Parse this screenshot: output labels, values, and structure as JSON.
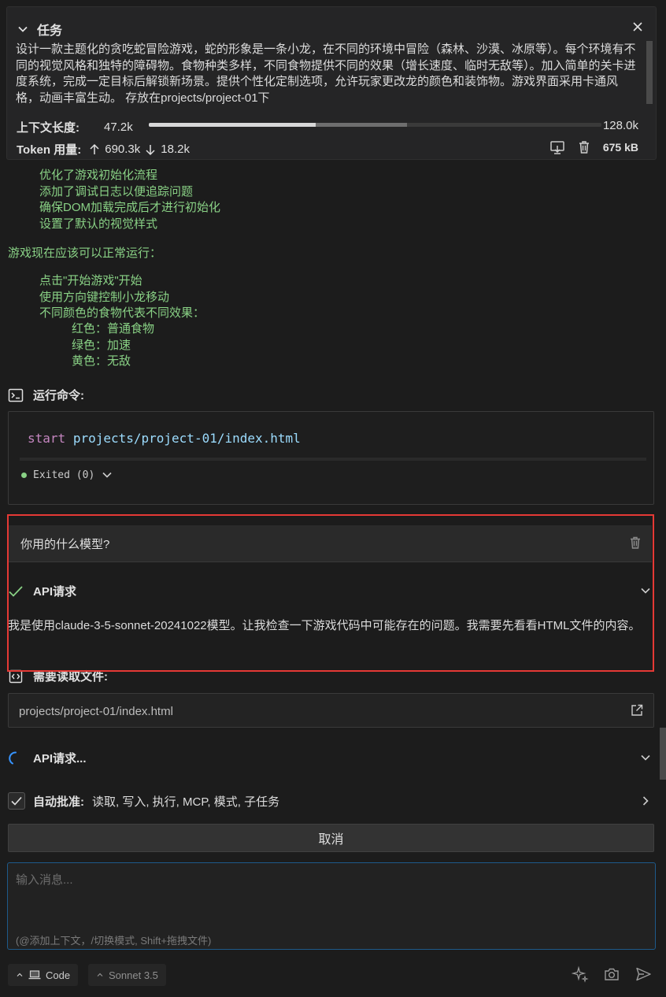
{
  "task": {
    "title": "任务",
    "description": "设计一款主题化的贪吃蛇冒险游戏，蛇的形象是一条小龙，在不同的环境中冒险（森林、沙漠、冰原等）。每个环境有不同的视觉风格和独特的障碍物。食物种类多样，不同食物提供不同的效果（增长速度、临时无敌等）。加入简单的关卡进度系统，完成一定目标后解锁新场景。提供个性化定制选项，允许玩家更改龙的颜色和装饰物。游戏界面采用卡通风格，动画丰富生动。 存放在projects/project-01下",
    "context_label": "上下文长度:",
    "context_used": "47.2k",
    "context_max": "128.0k",
    "context_used_fraction": 0.369,
    "context_cache_fraction": 0.201,
    "token_label": "Token 用量:",
    "tokens_in": "690.3k",
    "tokens_out": "18.2k",
    "size": "675 kB"
  },
  "assistant": {
    "list1": [
      "优化了游戏初始化流程",
      "添加了调试日志以便追踪问题",
      "确保DOM加载完成后才进行初始化",
      "设置了默认的视觉样式"
    ],
    "line": "游戏现在应该可以正常运行：",
    "list2": [
      "点击\"开始游戏\"开始",
      "使用方向键控制小龙移动",
      "不同颜色的食物代表不同效果："
    ],
    "list3": [
      "红色：普通食物",
      "绿色：加速",
      "黄色：无敌"
    ]
  },
  "run": {
    "label": "运行命令:",
    "keyword": "start",
    "argument": "projects/project-01/index.html",
    "status": "Exited (0)"
  },
  "question": "你用的什么模型?",
  "api1": {
    "label": "API请求",
    "answer": "我是使用claude-3-5-sonnet-20241022模型。让我检查一下游戏代码中可能存在的问题。我需要先看看HTML文件的内容。"
  },
  "read": {
    "label": "需要读取文件:",
    "path": "projects/project-01/index.html"
  },
  "api2": {
    "label": "API请求..."
  },
  "auto_approve": {
    "label": "自动批准:",
    "items": "读取, 写入, 执行, MCP, 模式, 子任务"
  },
  "cancel_label": "取消",
  "input": {
    "placeholder": "输入消息...",
    "hint": "(@添加上下文，/切换模式, Shift+拖拽文件)"
  },
  "mode": "Code",
  "model": "Sonnet 3.5",
  "colors": {
    "accent_green": "#89d185",
    "highlight_red": "#e53935",
    "focus_blue": "#1e5a8a"
  }
}
